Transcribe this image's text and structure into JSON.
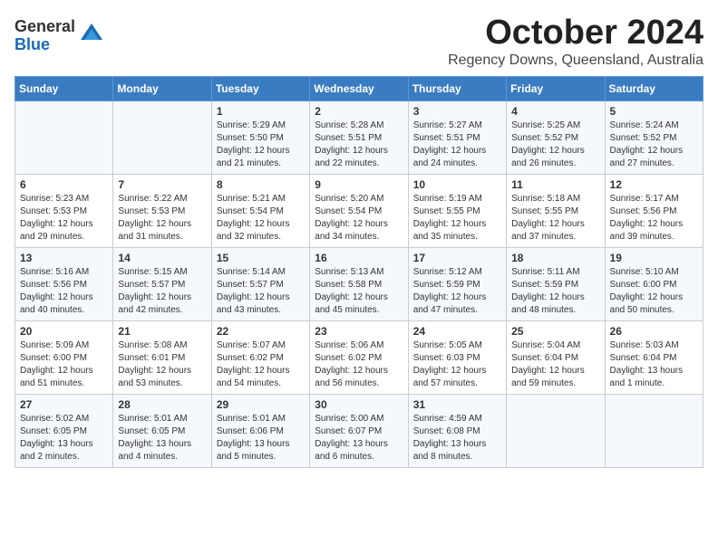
{
  "logo": {
    "general": "General",
    "blue": "Blue"
  },
  "title": "October 2024",
  "subtitle": "Regency Downs, Queensland, Australia",
  "headers": [
    "Sunday",
    "Monday",
    "Tuesday",
    "Wednesday",
    "Thursday",
    "Friday",
    "Saturday"
  ],
  "weeks": [
    [
      {
        "day": "",
        "sunrise": "",
        "sunset": "",
        "daylight": ""
      },
      {
        "day": "",
        "sunrise": "",
        "sunset": "",
        "daylight": ""
      },
      {
        "day": "1",
        "sunrise": "Sunrise: 5:29 AM",
        "sunset": "Sunset: 5:50 PM",
        "daylight": "Daylight: 12 hours and 21 minutes."
      },
      {
        "day": "2",
        "sunrise": "Sunrise: 5:28 AM",
        "sunset": "Sunset: 5:51 PM",
        "daylight": "Daylight: 12 hours and 22 minutes."
      },
      {
        "day": "3",
        "sunrise": "Sunrise: 5:27 AM",
        "sunset": "Sunset: 5:51 PM",
        "daylight": "Daylight: 12 hours and 24 minutes."
      },
      {
        "day": "4",
        "sunrise": "Sunrise: 5:25 AM",
        "sunset": "Sunset: 5:52 PM",
        "daylight": "Daylight: 12 hours and 26 minutes."
      },
      {
        "day": "5",
        "sunrise": "Sunrise: 5:24 AM",
        "sunset": "Sunset: 5:52 PM",
        "daylight": "Daylight: 12 hours and 27 minutes."
      }
    ],
    [
      {
        "day": "6",
        "sunrise": "Sunrise: 5:23 AM",
        "sunset": "Sunset: 5:53 PM",
        "daylight": "Daylight: 12 hours and 29 minutes."
      },
      {
        "day": "7",
        "sunrise": "Sunrise: 5:22 AM",
        "sunset": "Sunset: 5:53 PM",
        "daylight": "Daylight: 12 hours and 31 minutes."
      },
      {
        "day": "8",
        "sunrise": "Sunrise: 5:21 AM",
        "sunset": "Sunset: 5:54 PM",
        "daylight": "Daylight: 12 hours and 32 minutes."
      },
      {
        "day": "9",
        "sunrise": "Sunrise: 5:20 AM",
        "sunset": "Sunset: 5:54 PM",
        "daylight": "Daylight: 12 hours and 34 minutes."
      },
      {
        "day": "10",
        "sunrise": "Sunrise: 5:19 AM",
        "sunset": "Sunset: 5:55 PM",
        "daylight": "Daylight: 12 hours and 35 minutes."
      },
      {
        "day": "11",
        "sunrise": "Sunrise: 5:18 AM",
        "sunset": "Sunset: 5:55 PM",
        "daylight": "Daylight: 12 hours and 37 minutes."
      },
      {
        "day": "12",
        "sunrise": "Sunrise: 5:17 AM",
        "sunset": "Sunset: 5:56 PM",
        "daylight": "Daylight: 12 hours and 39 minutes."
      }
    ],
    [
      {
        "day": "13",
        "sunrise": "Sunrise: 5:16 AM",
        "sunset": "Sunset: 5:56 PM",
        "daylight": "Daylight: 12 hours and 40 minutes."
      },
      {
        "day": "14",
        "sunrise": "Sunrise: 5:15 AM",
        "sunset": "Sunset: 5:57 PM",
        "daylight": "Daylight: 12 hours and 42 minutes."
      },
      {
        "day": "15",
        "sunrise": "Sunrise: 5:14 AM",
        "sunset": "Sunset: 5:57 PM",
        "daylight": "Daylight: 12 hours and 43 minutes."
      },
      {
        "day": "16",
        "sunrise": "Sunrise: 5:13 AM",
        "sunset": "Sunset: 5:58 PM",
        "daylight": "Daylight: 12 hours and 45 minutes."
      },
      {
        "day": "17",
        "sunrise": "Sunrise: 5:12 AM",
        "sunset": "Sunset: 5:59 PM",
        "daylight": "Daylight: 12 hours and 47 minutes."
      },
      {
        "day": "18",
        "sunrise": "Sunrise: 5:11 AM",
        "sunset": "Sunset: 5:59 PM",
        "daylight": "Daylight: 12 hours and 48 minutes."
      },
      {
        "day": "19",
        "sunrise": "Sunrise: 5:10 AM",
        "sunset": "Sunset: 6:00 PM",
        "daylight": "Daylight: 12 hours and 50 minutes."
      }
    ],
    [
      {
        "day": "20",
        "sunrise": "Sunrise: 5:09 AM",
        "sunset": "Sunset: 6:00 PM",
        "daylight": "Daylight: 12 hours and 51 minutes."
      },
      {
        "day": "21",
        "sunrise": "Sunrise: 5:08 AM",
        "sunset": "Sunset: 6:01 PM",
        "daylight": "Daylight: 12 hours and 53 minutes."
      },
      {
        "day": "22",
        "sunrise": "Sunrise: 5:07 AM",
        "sunset": "Sunset: 6:02 PM",
        "daylight": "Daylight: 12 hours and 54 minutes."
      },
      {
        "day": "23",
        "sunrise": "Sunrise: 5:06 AM",
        "sunset": "Sunset: 6:02 PM",
        "daylight": "Daylight: 12 hours and 56 minutes."
      },
      {
        "day": "24",
        "sunrise": "Sunrise: 5:05 AM",
        "sunset": "Sunset: 6:03 PM",
        "daylight": "Daylight: 12 hours and 57 minutes."
      },
      {
        "day": "25",
        "sunrise": "Sunrise: 5:04 AM",
        "sunset": "Sunset: 6:04 PM",
        "daylight": "Daylight: 12 hours and 59 minutes."
      },
      {
        "day": "26",
        "sunrise": "Sunrise: 5:03 AM",
        "sunset": "Sunset: 6:04 PM",
        "daylight": "Daylight: 13 hours and 1 minute."
      }
    ],
    [
      {
        "day": "27",
        "sunrise": "Sunrise: 5:02 AM",
        "sunset": "Sunset: 6:05 PM",
        "daylight": "Daylight: 13 hours and 2 minutes."
      },
      {
        "day": "28",
        "sunrise": "Sunrise: 5:01 AM",
        "sunset": "Sunset: 6:05 PM",
        "daylight": "Daylight: 13 hours and 4 minutes."
      },
      {
        "day": "29",
        "sunrise": "Sunrise: 5:01 AM",
        "sunset": "Sunset: 6:06 PM",
        "daylight": "Daylight: 13 hours and 5 minutes."
      },
      {
        "day": "30",
        "sunrise": "Sunrise: 5:00 AM",
        "sunset": "Sunset: 6:07 PM",
        "daylight": "Daylight: 13 hours and 6 minutes."
      },
      {
        "day": "31",
        "sunrise": "Sunrise: 4:59 AM",
        "sunset": "Sunset: 6:08 PM",
        "daylight": "Daylight: 13 hours and 8 minutes."
      },
      {
        "day": "",
        "sunrise": "",
        "sunset": "",
        "daylight": ""
      },
      {
        "day": "",
        "sunrise": "",
        "sunset": "",
        "daylight": ""
      }
    ]
  ]
}
